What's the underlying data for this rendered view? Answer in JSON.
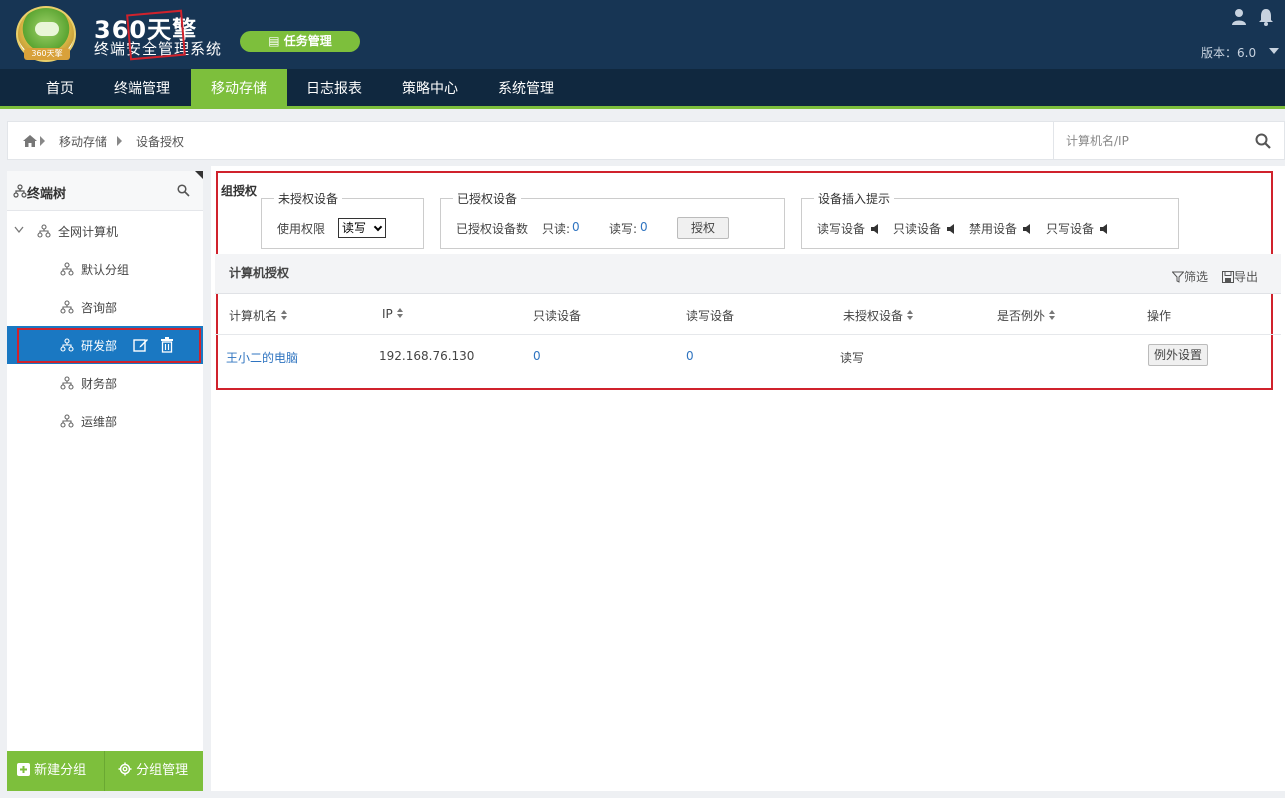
{
  "header": {
    "brand_title": "360天擎",
    "brand_subtitle": "终端安全管理系统",
    "badge_text": "360天擎",
    "task_button": "任务管理",
    "version": "版本：6.0"
  },
  "nav": {
    "items": [
      "首页",
      "终端管理",
      "移动存储",
      "日志报表",
      "策略中心",
      "系统管理"
    ],
    "active": "移动存储"
  },
  "breadcrumb": {
    "items": [
      "移动存储",
      "设备授权"
    ]
  },
  "search": {
    "placeholder": "计算机名/IP"
  },
  "sidebar": {
    "title": "终端树",
    "root": "全网计算机",
    "groups": [
      "默认分组",
      "咨询部",
      "研发部",
      "财务部",
      "运维部"
    ],
    "selected": "研发部",
    "footer": {
      "new_group": "新建分组",
      "manage_group": "分组管理"
    }
  },
  "group_auth": {
    "label": "组授权",
    "unauthorized": {
      "legend": "未授权设备",
      "perm_label": "使用权限",
      "perm_value": "读写"
    },
    "authorized": {
      "legend": "已授权设备",
      "count_label": "已授权设备数",
      "readonly_label": "只读:",
      "readonly_count": "0",
      "readwrite_label": "读写:",
      "readwrite_count": "0",
      "auth_button": "授权"
    },
    "insert_hint": {
      "legend": "设备插入提示",
      "items": [
        "读写设备",
        "只读设备",
        "禁用设备",
        "只写设备"
      ]
    }
  },
  "computer_auth": {
    "title": "计算机授权",
    "filter": "筛选",
    "export": "导出",
    "columns": [
      "计算机名",
      "IP",
      "只读设备",
      "读写设备",
      "未授权设备",
      "是否例外",
      "操作"
    ],
    "rows": [
      {
        "name": "王小二的电脑",
        "ip": "192.168.76.130",
        "readonly": "0",
        "readwrite": "0",
        "unauthorized": "读写",
        "exception": "",
        "action": "例外设置"
      }
    ]
  },
  "colors": {
    "header_bg": "#173554",
    "nav_bg": "#10283f",
    "accent_green": "#7dbf3c",
    "selected_blue": "#1a78c2",
    "highlight_red": "#d0222c",
    "link_blue": "#2f74c0"
  }
}
